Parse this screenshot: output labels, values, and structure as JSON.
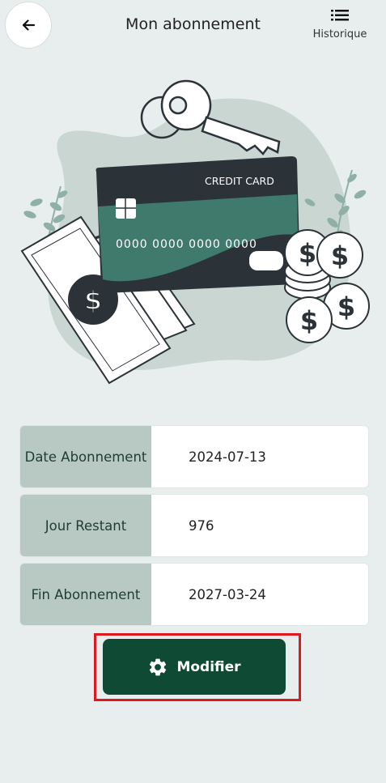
{
  "header": {
    "title": "Mon abonnement",
    "history_label": "Historique",
    "back_icon": "arrow-left-icon",
    "history_icon": "list-icon"
  },
  "illustration": {
    "card_title": "CREDIT CARD",
    "card_number": "0000  0000  0000  0000"
  },
  "subscription": {
    "rows": [
      {
        "label": "Date Abonnement",
        "value": "2024-07-13"
      },
      {
        "label": "Jour Restant",
        "value": "976"
      },
      {
        "label": "Fin Abonnement",
        "value": "2027-03-24"
      }
    ]
  },
  "actions": {
    "modify_label": "Modifier",
    "modify_icon": "gear-icon"
  },
  "colors": {
    "background": "#e8eeed",
    "label_bg": "#b7c9c2",
    "primary": "#0f4a35",
    "card_dark": "#2c3338",
    "card_teal": "#3f7a6d",
    "highlight": "#e0191f"
  }
}
